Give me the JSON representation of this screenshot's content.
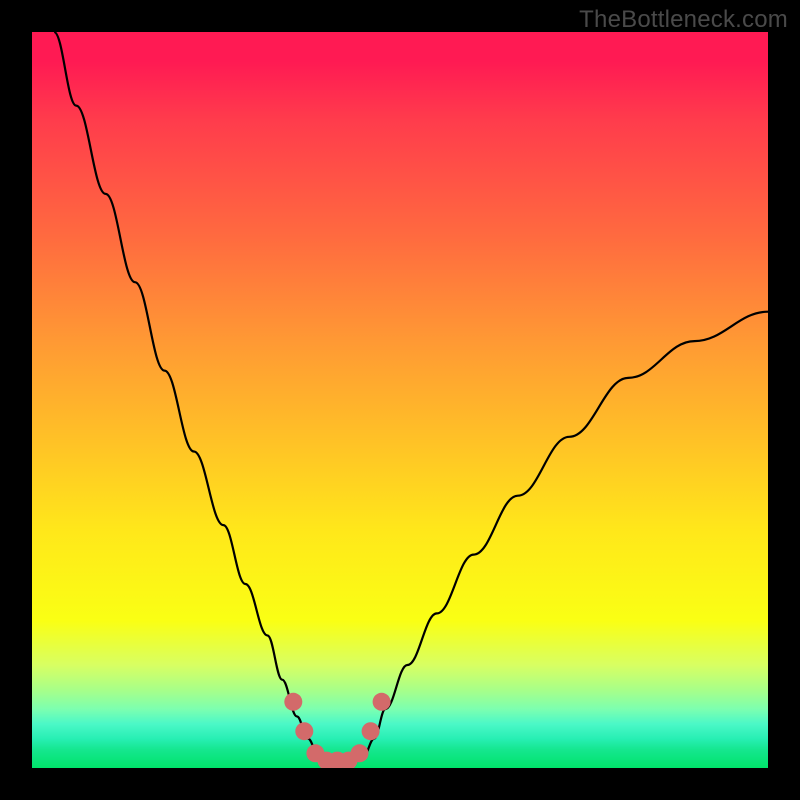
{
  "watermark": "TheBottleneck.com",
  "chart_data": {
    "type": "line",
    "title": "",
    "xlabel": "",
    "ylabel": "",
    "xlim": [
      0,
      100
    ],
    "ylim": [
      0,
      100
    ],
    "series": [
      {
        "name": "bottleneck-curve",
        "x": [
          3,
          6,
          10,
          14,
          18,
          22,
          26,
          29,
          32,
          34,
          36,
          37.5,
          39,
          41,
          43,
          45,
          46.5,
          48,
          51,
          55,
          60,
          66,
          73,
          81,
          90,
          100
        ],
        "y": [
          100,
          90,
          78,
          66,
          54,
          43,
          33,
          25,
          18,
          12,
          7,
          4,
          1.5,
          0.5,
          0.5,
          1.5,
          4,
          8,
          14,
          21,
          29,
          37,
          45,
          53,
          58,
          62
        ]
      },
      {
        "name": "optimal-markers",
        "x": [
          35.5,
          37,
          38.5,
          40,
          41.5,
          43,
          44.5,
          46,
          47.5
        ],
        "y": [
          9,
          5,
          2,
          1,
          1,
          1,
          2,
          5,
          9
        ]
      }
    ],
    "colors": {
      "curve": "#000000",
      "markers": "#d36a6a"
    }
  }
}
